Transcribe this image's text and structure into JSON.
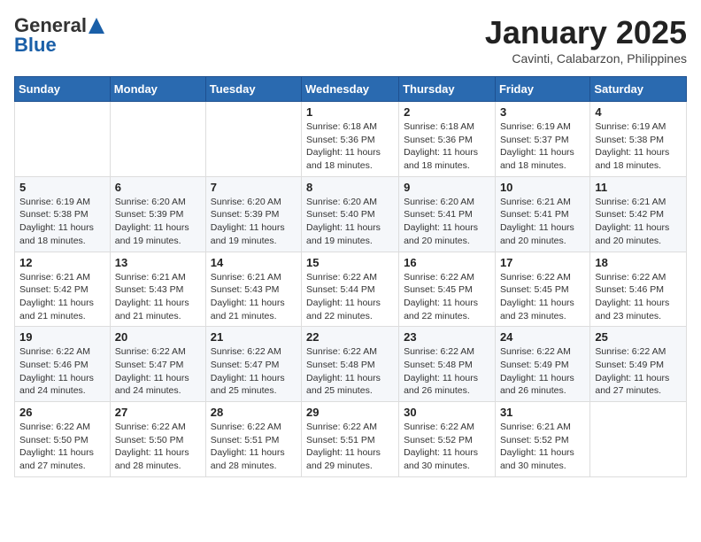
{
  "header": {
    "logo_general": "General",
    "logo_blue": "Blue",
    "month_title": "January 2025",
    "subtitle": "Cavinti, Calabarzon, Philippines"
  },
  "weekdays": [
    "Sunday",
    "Monday",
    "Tuesday",
    "Wednesday",
    "Thursday",
    "Friday",
    "Saturday"
  ],
  "weeks": [
    [
      {
        "day": "",
        "info": ""
      },
      {
        "day": "",
        "info": ""
      },
      {
        "day": "",
        "info": ""
      },
      {
        "day": "1",
        "info": "Sunrise: 6:18 AM\nSunset: 5:36 PM\nDaylight: 11 hours and 18 minutes."
      },
      {
        "day": "2",
        "info": "Sunrise: 6:18 AM\nSunset: 5:36 PM\nDaylight: 11 hours and 18 minutes."
      },
      {
        "day": "3",
        "info": "Sunrise: 6:19 AM\nSunset: 5:37 PM\nDaylight: 11 hours and 18 minutes."
      },
      {
        "day": "4",
        "info": "Sunrise: 6:19 AM\nSunset: 5:38 PM\nDaylight: 11 hours and 18 minutes."
      }
    ],
    [
      {
        "day": "5",
        "info": "Sunrise: 6:19 AM\nSunset: 5:38 PM\nDaylight: 11 hours and 18 minutes."
      },
      {
        "day": "6",
        "info": "Sunrise: 6:20 AM\nSunset: 5:39 PM\nDaylight: 11 hours and 19 minutes."
      },
      {
        "day": "7",
        "info": "Sunrise: 6:20 AM\nSunset: 5:39 PM\nDaylight: 11 hours and 19 minutes."
      },
      {
        "day": "8",
        "info": "Sunrise: 6:20 AM\nSunset: 5:40 PM\nDaylight: 11 hours and 19 minutes."
      },
      {
        "day": "9",
        "info": "Sunrise: 6:20 AM\nSunset: 5:41 PM\nDaylight: 11 hours and 20 minutes."
      },
      {
        "day": "10",
        "info": "Sunrise: 6:21 AM\nSunset: 5:41 PM\nDaylight: 11 hours and 20 minutes."
      },
      {
        "day": "11",
        "info": "Sunrise: 6:21 AM\nSunset: 5:42 PM\nDaylight: 11 hours and 20 minutes."
      }
    ],
    [
      {
        "day": "12",
        "info": "Sunrise: 6:21 AM\nSunset: 5:42 PM\nDaylight: 11 hours and 21 minutes."
      },
      {
        "day": "13",
        "info": "Sunrise: 6:21 AM\nSunset: 5:43 PM\nDaylight: 11 hours and 21 minutes."
      },
      {
        "day": "14",
        "info": "Sunrise: 6:21 AM\nSunset: 5:43 PM\nDaylight: 11 hours and 21 minutes."
      },
      {
        "day": "15",
        "info": "Sunrise: 6:22 AM\nSunset: 5:44 PM\nDaylight: 11 hours and 22 minutes."
      },
      {
        "day": "16",
        "info": "Sunrise: 6:22 AM\nSunset: 5:45 PM\nDaylight: 11 hours and 22 minutes."
      },
      {
        "day": "17",
        "info": "Sunrise: 6:22 AM\nSunset: 5:45 PM\nDaylight: 11 hours and 23 minutes."
      },
      {
        "day": "18",
        "info": "Sunrise: 6:22 AM\nSunset: 5:46 PM\nDaylight: 11 hours and 23 minutes."
      }
    ],
    [
      {
        "day": "19",
        "info": "Sunrise: 6:22 AM\nSunset: 5:46 PM\nDaylight: 11 hours and 24 minutes."
      },
      {
        "day": "20",
        "info": "Sunrise: 6:22 AM\nSunset: 5:47 PM\nDaylight: 11 hours and 24 minutes."
      },
      {
        "day": "21",
        "info": "Sunrise: 6:22 AM\nSunset: 5:47 PM\nDaylight: 11 hours and 25 minutes."
      },
      {
        "day": "22",
        "info": "Sunrise: 6:22 AM\nSunset: 5:48 PM\nDaylight: 11 hours and 25 minutes."
      },
      {
        "day": "23",
        "info": "Sunrise: 6:22 AM\nSunset: 5:48 PM\nDaylight: 11 hours and 26 minutes."
      },
      {
        "day": "24",
        "info": "Sunrise: 6:22 AM\nSunset: 5:49 PM\nDaylight: 11 hours and 26 minutes."
      },
      {
        "day": "25",
        "info": "Sunrise: 6:22 AM\nSunset: 5:49 PM\nDaylight: 11 hours and 27 minutes."
      }
    ],
    [
      {
        "day": "26",
        "info": "Sunrise: 6:22 AM\nSunset: 5:50 PM\nDaylight: 11 hours and 27 minutes."
      },
      {
        "day": "27",
        "info": "Sunrise: 6:22 AM\nSunset: 5:50 PM\nDaylight: 11 hours and 28 minutes."
      },
      {
        "day": "28",
        "info": "Sunrise: 6:22 AM\nSunset: 5:51 PM\nDaylight: 11 hours and 28 minutes."
      },
      {
        "day": "29",
        "info": "Sunrise: 6:22 AM\nSunset: 5:51 PM\nDaylight: 11 hours and 29 minutes."
      },
      {
        "day": "30",
        "info": "Sunrise: 6:22 AM\nSunset: 5:52 PM\nDaylight: 11 hours and 30 minutes."
      },
      {
        "day": "31",
        "info": "Sunrise: 6:21 AM\nSunset: 5:52 PM\nDaylight: 11 hours and 30 minutes."
      },
      {
        "day": "",
        "info": ""
      }
    ]
  ]
}
